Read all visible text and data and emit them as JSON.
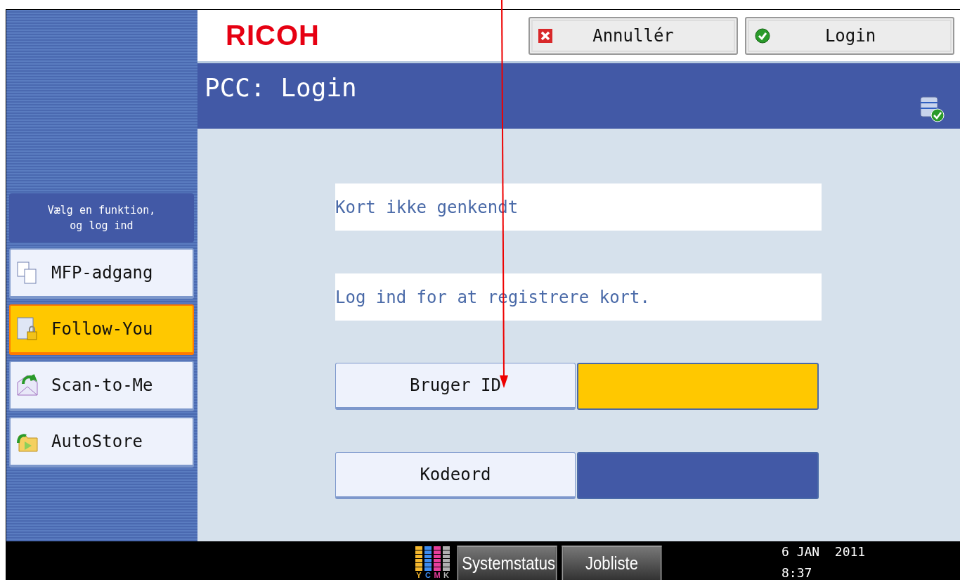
{
  "header": {
    "logo": "RICOH",
    "buttons": [
      {
        "kind": "cancel",
        "label": "Annullér"
      },
      {
        "kind": "ok",
        "label": "Login"
      }
    ]
  },
  "title_bar": {
    "title": "PCC: Login"
  },
  "sidebar": {
    "hint": "Vælg en funktion,\nog log ind",
    "items": [
      {
        "label": "MFP-adgang",
        "kind": "pages",
        "selected": false
      },
      {
        "label": "Follow-You",
        "kind": "locked-doc",
        "selected": true
      },
      {
        "label": "Scan-to-Me",
        "kind": "envelope",
        "selected": false
      },
      {
        "label": "AutoStore",
        "kind": "folder",
        "selected": false
      }
    ]
  },
  "messages": [
    "Kort ikke genkendt",
    "Log ind for at registrere kort."
  ],
  "fields": [
    {
      "label": "Bruger ID",
      "active": true
    },
    {
      "label": "Kodeord",
      "active": false
    }
  ],
  "status_bar": {
    "toner": [
      {
        "letter": "Y",
        "color": "#f5b82e"
      },
      {
        "letter": "C",
        "color": "#3d8cf0"
      },
      {
        "letter": "M",
        "color": "#e83e9c"
      },
      {
        "letter": "K",
        "color": "#b0b0b0"
      }
    ],
    "buttons": [
      "Systemstatus",
      "Jobliste"
    ],
    "date": "6 JAN  2011",
    "time": "8:37"
  }
}
